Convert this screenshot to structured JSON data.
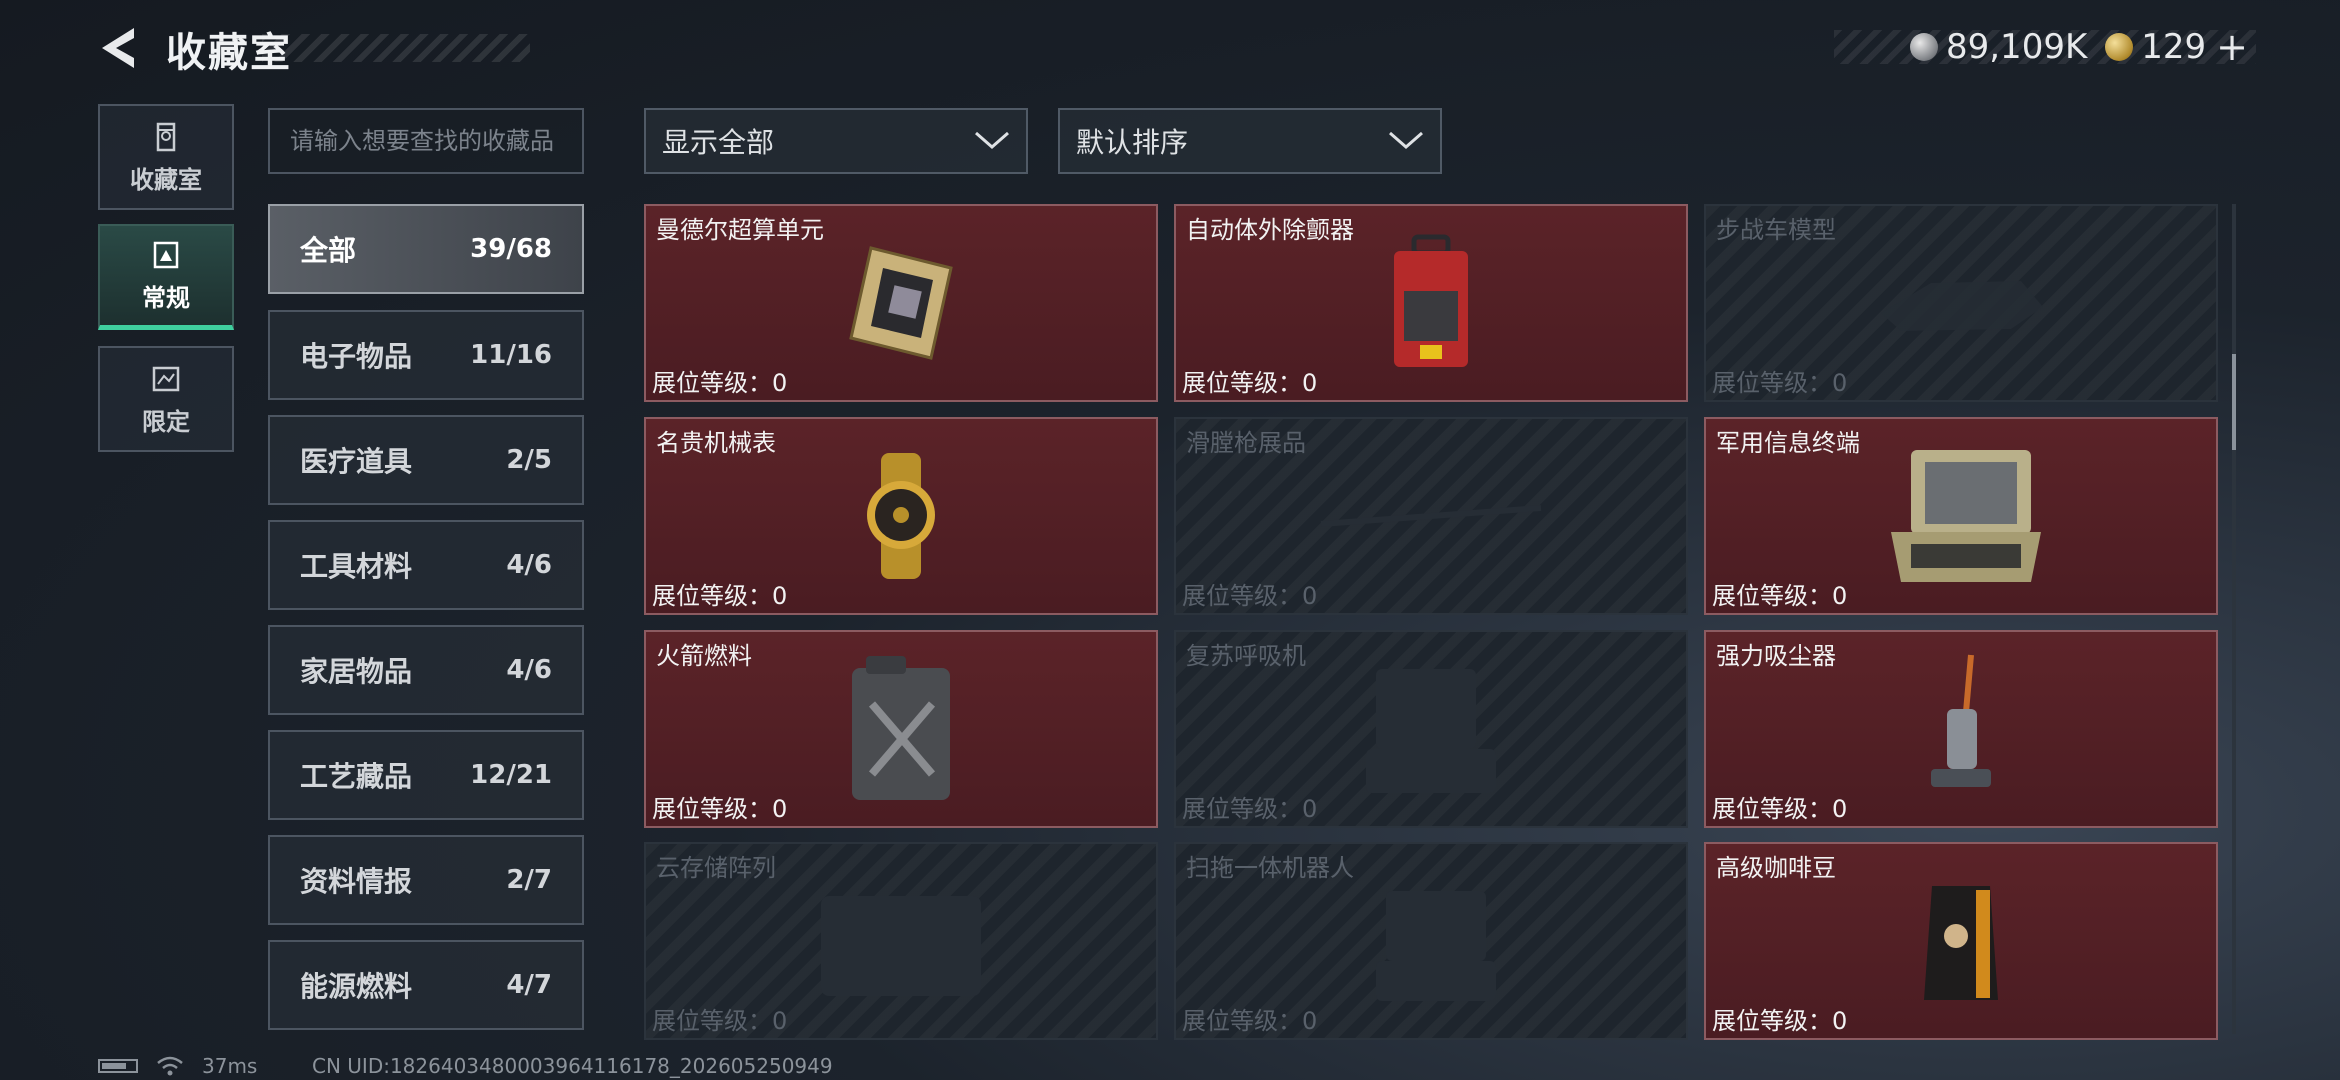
{
  "header": {
    "title": "收藏室",
    "currency": [
      {
        "icon": "silver-coin-icon",
        "value": "89,109K"
      },
      {
        "icon": "gold-coin-icon",
        "value": "129"
      }
    ],
    "add_label": "+"
  },
  "left_nav": [
    {
      "label": "收藏室",
      "icon": "collection-room-icon",
      "active": false
    },
    {
      "label": "常规",
      "icon": "regular-icon",
      "active": true
    },
    {
      "label": "限定",
      "icon": "limited-icon",
      "active": false
    }
  ],
  "search": {
    "placeholder": "请输入想要查找的收藏品"
  },
  "categories": [
    {
      "name": "全部",
      "count": "39/68",
      "active": true
    },
    {
      "name": "电子物品",
      "count": "11/16"
    },
    {
      "name": "医疗道具",
      "count": "2/5"
    },
    {
      "name": "工具材料",
      "count": "4/6"
    },
    {
      "name": "家居物品",
      "count": "4/6"
    },
    {
      "name": "工艺藏品",
      "count": "12/21"
    },
    {
      "name": "资料情报",
      "count": "2/7"
    },
    {
      "name": "能源燃料",
      "count": "4/7"
    }
  ],
  "filters": {
    "display": "显示全部",
    "sort": "默认排序"
  },
  "items": [
    {
      "name": "曼德尔超算单元",
      "level": "展位等级：0",
      "owned": true,
      "icon": "compute-unit-icon"
    },
    {
      "name": "自动体外除颤器",
      "level": "展位等级：0",
      "owned": true,
      "icon": "defibrillator-icon"
    },
    {
      "name": "步战车模型",
      "level": "展位等级：0",
      "owned": false,
      "icon": "ifv-model-icon"
    },
    {
      "name": "名贵机械表",
      "level": "展位等级：0",
      "owned": true,
      "icon": "watch-icon"
    },
    {
      "name": "滑膛枪展品",
      "level": "展位等级：0",
      "owned": false,
      "icon": "musket-icon"
    },
    {
      "name": "军用信息终端",
      "level": "展位等级：0",
      "owned": true,
      "icon": "military-terminal-icon"
    },
    {
      "name": "火箭燃料",
      "level": "展位等级：0",
      "owned": true,
      "icon": "fuel-can-icon"
    },
    {
      "name": "复苏呼吸机",
      "level": "展位等级：0",
      "owned": false,
      "icon": "ventilator-icon"
    },
    {
      "name": "强力吸尘器",
      "level": "展位等级：0",
      "owned": true,
      "icon": "vacuum-icon"
    },
    {
      "name": "云存储阵列",
      "level": "展位等级：0",
      "owned": false,
      "icon": "storage-array-icon"
    },
    {
      "name": "扫拖一体机器人",
      "level": "展位等级：0",
      "owned": false,
      "icon": "robot-mop-icon"
    },
    {
      "name": "高级咖啡豆",
      "level": "展位等级：0",
      "owned": true,
      "icon": "coffee-bag-icon"
    }
  ],
  "footer": {
    "ping": "37ms",
    "uid": "CN UID:18264034800039641161​78_202605250949"
  },
  "colors": {
    "owned_card": "#4a1c22",
    "active_tab_accent": "#3fcf9e",
    "background": "#1c232c"
  }
}
